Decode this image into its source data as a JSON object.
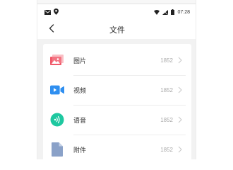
{
  "status_bar": {
    "time": "07:28",
    "icons": [
      "mail-icon",
      "location-icon",
      "wifi-icon",
      "no-signal-icon",
      "battery-icon"
    ]
  },
  "nav": {
    "title": "文件",
    "back_icon": "chevron-left-icon"
  },
  "items": [
    {
      "label": "图片",
      "count": "1852",
      "icon": "image-icon",
      "color": "#f05a6a"
    },
    {
      "label": "视频",
      "count": "1852",
      "icon": "video-icon",
      "color": "#2f8ff0"
    },
    {
      "label": "语音",
      "count": "1852",
      "icon": "voice-icon",
      "color": "#1ec8a0"
    },
    {
      "label": "附件",
      "count": "1852",
      "icon": "attachment-icon",
      "color": "#8aa1c8"
    }
  ]
}
